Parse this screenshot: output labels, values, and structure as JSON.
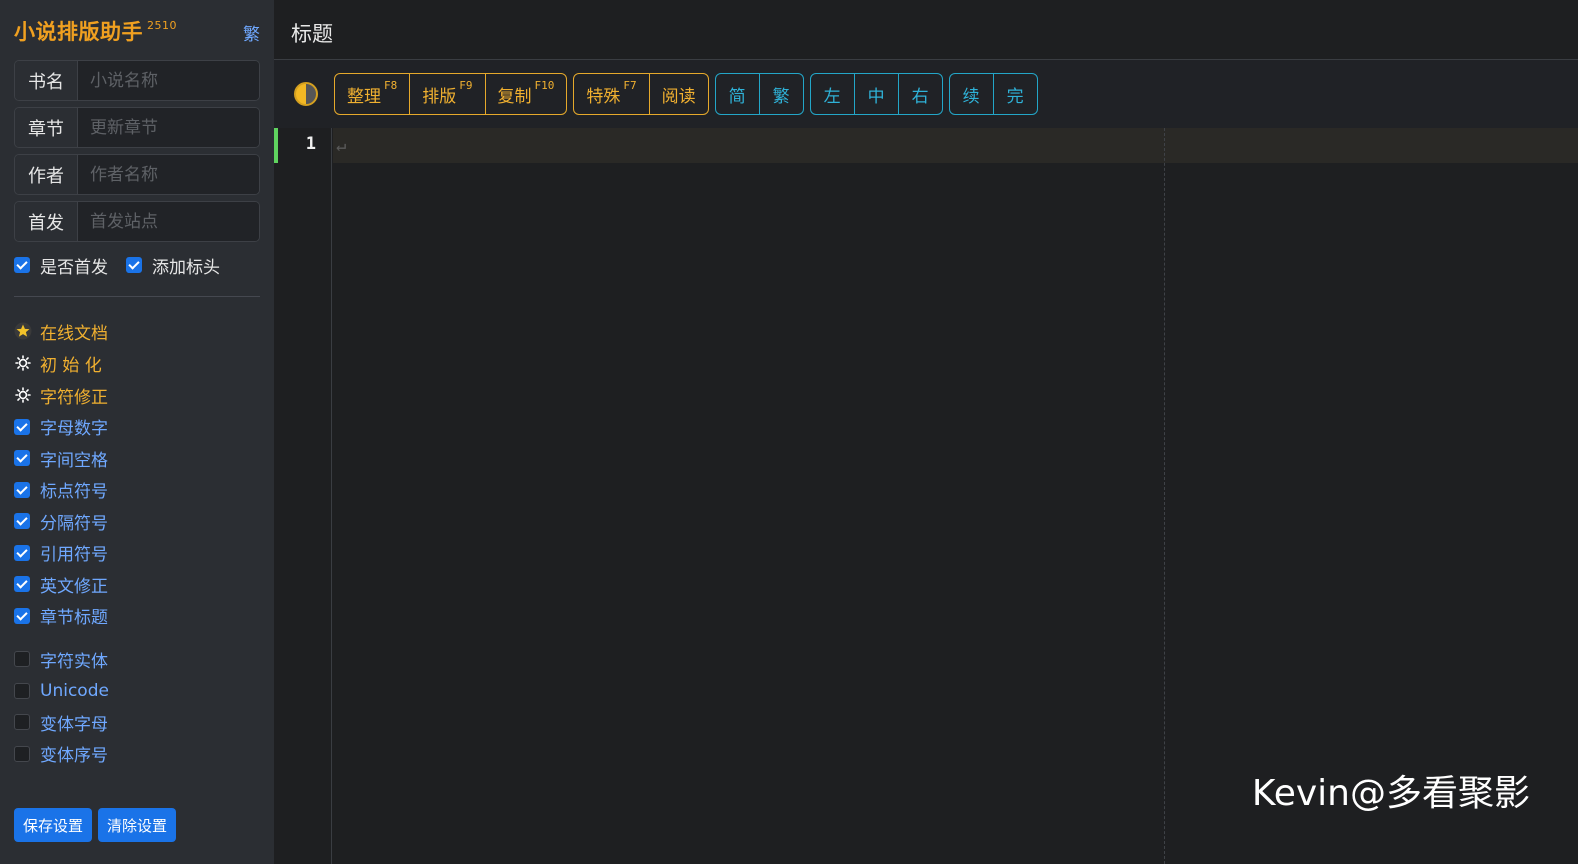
{
  "sidebar": {
    "brand": "小说排版助手",
    "version": "2510",
    "lang_toggle": "繁",
    "fields": [
      {
        "label": "书名",
        "placeholder": "小说名称",
        "value": ""
      },
      {
        "label": "章节",
        "placeholder": "更新章节",
        "value": ""
      },
      {
        "label": "作者",
        "placeholder": "作者名称",
        "value": ""
      },
      {
        "label": "首发",
        "placeholder": "首发站点",
        "value": ""
      }
    ],
    "checks": [
      {
        "label": "是否首发",
        "checked": true
      },
      {
        "label": "添加标头",
        "checked": true
      }
    ],
    "menu": [
      {
        "label": "在线文档",
        "icon": "star-icon"
      },
      {
        "label": "初 始 化",
        "icon": "gear-icon"
      },
      {
        "label": "字符修正",
        "icon": "gear-icon"
      }
    ],
    "options_on": [
      "字母数字",
      "字间空格",
      "标点符号",
      "分隔符号",
      "引用符号",
      "英文修正",
      "章节标题"
    ],
    "options_off": [
      "字符实体",
      "Unicode",
      "变体字母",
      "变体序号"
    ],
    "buttons": {
      "save": "保存设置",
      "clear": "清除设置"
    }
  },
  "header": {
    "title": "标题"
  },
  "toolbar": {
    "group1": [
      {
        "label": "整理",
        "key": "F8"
      },
      {
        "label": "排版",
        "key": "F9"
      },
      {
        "label": "复制",
        "key": "F10"
      }
    ],
    "group2": [
      {
        "label": "特殊",
        "key": "F7"
      },
      {
        "label": "阅读",
        "key": ""
      }
    ],
    "group3": [
      "简",
      "繁"
    ],
    "group4": [
      "左",
      "中",
      "右"
    ],
    "group5": [
      "续",
      "完"
    ]
  },
  "editor": {
    "line_number": "1",
    "cursor_glyph": "↵"
  },
  "watermark": "Kevin@多看聚影",
  "colors": {
    "accent_gold": "#f0b030",
    "accent_blue": "#1a73e8",
    "accent_cyan": "#2fb2d8"
  }
}
